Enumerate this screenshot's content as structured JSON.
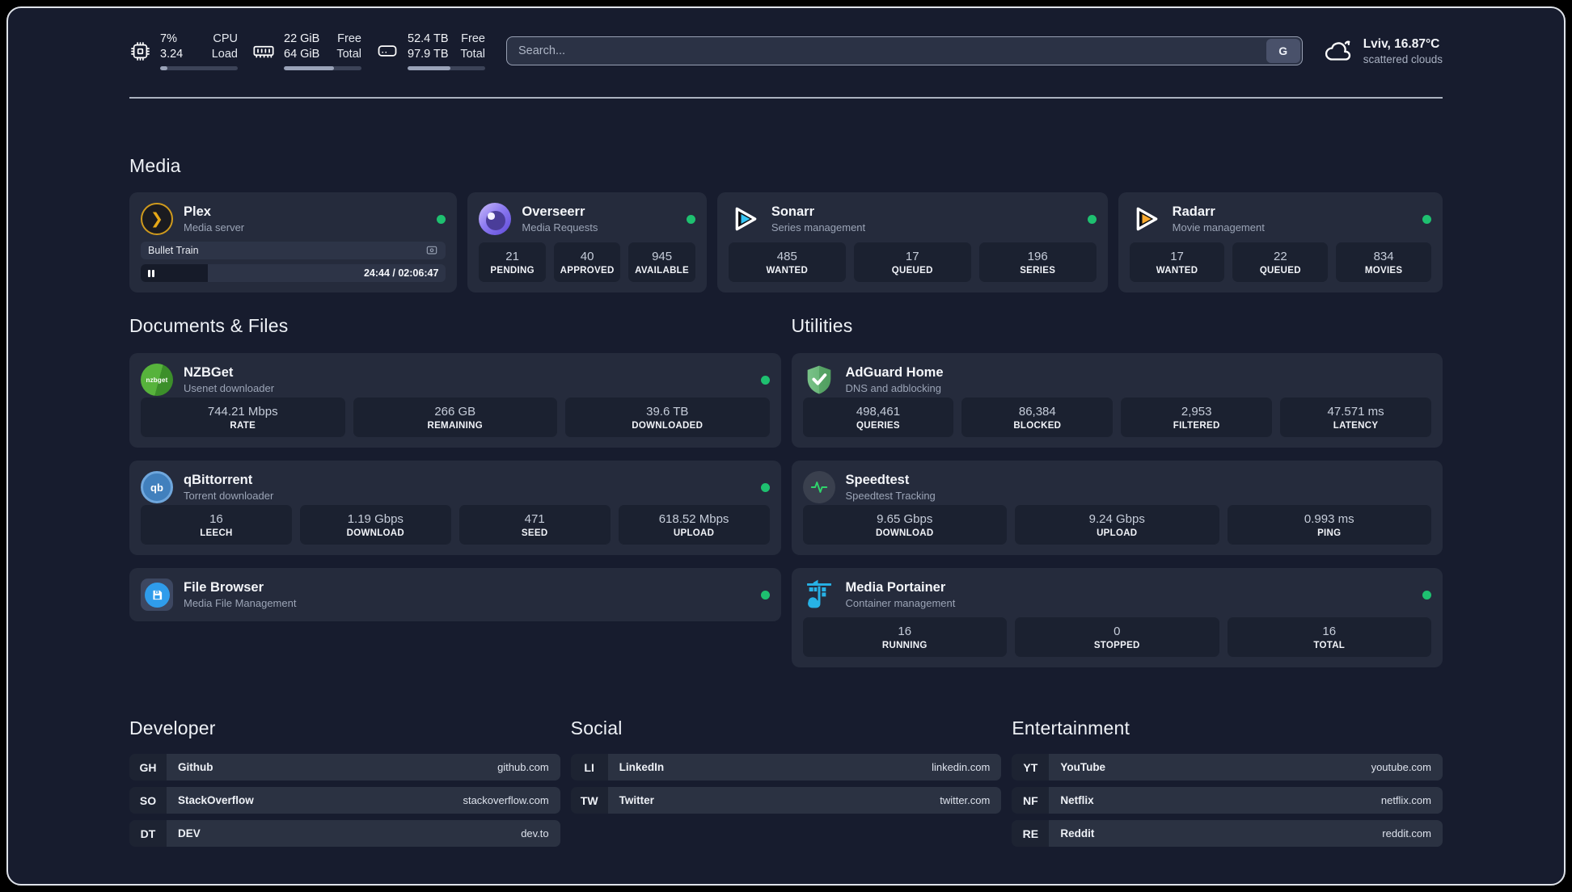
{
  "colors": {
    "status_online": "#1ec070",
    "plex": "#e5a00d",
    "sonarr": "#35c5f4",
    "radarr": "#f7a82d",
    "adguard": "#68b477",
    "portainer": "#27b2e6",
    "qbittorrent": "#4180bd",
    "nzbget": "#46a42f",
    "filebrowser": "#2f9ceb",
    "speedtest_pulse": "#2fd46b",
    "overseerr": "#7b68ee"
  },
  "header": {
    "stats": [
      {
        "icon": "cpu-icon",
        "values": [
          "7%",
          "3.24"
        ],
        "labels": [
          "CPU",
          "Load"
        ],
        "progress_pct": 9
      },
      {
        "icon": "memory-icon",
        "values": [
          "22 GiB",
          "64 GiB"
        ],
        "labels": [
          "Free",
          "Total"
        ],
        "progress_pct": 65
      },
      {
        "icon": "disk-icon",
        "values": [
          "52.4 TB",
          "97.9 TB"
        ],
        "labels": [
          "Free",
          "Total"
        ],
        "progress_pct": 55
      }
    ],
    "search": {
      "placeholder": "Search...",
      "engine": "G"
    },
    "weather": {
      "title": "Lviv, 16.87°C",
      "subtitle": "scattered clouds"
    }
  },
  "media": {
    "heading": "Media",
    "cards": [
      {
        "title": "Plex",
        "subtitle": "Media server",
        "online": true,
        "player": {
          "track": "Bullet Train",
          "time": "24:44 / 02:06:47",
          "elapsed": "24:44",
          "total": "02:06:47",
          "progress_pct": 22,
          "state": "paused"
        }
      },
      {
        "title": "Overseerr",
        "subtitle": "Media Requests",
        "online": true,
        "stats": [
          {
            "value": "21",
            "label": "PENDING"
          },
          {
            "value": "40",
            "label": "APPROVED"
          },
          {
            "value": "945",
            "label": "AVAILABLE"
          }
        ]
      },
      {
        "title": "Sonarr",
        "subtitle": "Series management",
        "online": true,
        "stats": [
          {
            "value": "485",
            "label": "WANTED"
          },
          {
            "value": "17",
            "label": "QUEUED"
          },
          {
            "value": "196",
            "label": "SERIES"
          }
        ]
      },
      {
        "title": "Radarr",
        "subtitle": "Movie management",
        "online": true,
        "stats": [
          {
            "value": "17",
            "label": "WANTED"
          },
          {
            "value": "22",
            "label": "QUEUED"
          },
          {
            "value": "834",
            "label": "MOVIES"
          }
        ]
      }
    ]
  },
  "documents": {
    "heading": "Documents & Files",
    "cards": [
      {
        "title": "NZBGet",
        "subtitle": "Usenet downloader",
        "online": true,
        "icon_text": "nzbget",
        "stats": [
          {
            "value": "744.21 Mbps",
            "label": "RATE"
          },
          {
            "value": "266 GB",
            "label": "REMAINING"
          },
          {
            "value": "39.6 TB",
            "label": "DOWNLOADED"
          }
        ]
      },
      {
        "title": "qBittorrent",
        "subtitle": "Torrent downloader",
        "online": true,
        "icon_text": "qb",
        "stats": [
          {
            "value": "16",
            "label": "LEECH"
          },
          {
            "value": "1.19 Gbps",
            "label": "DOWNLOAD"
          },
          {
            "value": "471",
            "label": "SEED"
          },
          {
            "value": "618.52 Mbps",
            "label": "UPLOAD"
          }
        ]
      },
      {
        "title": "File Browser",
        "subtitle": "Media File Management",
        "online": true
      }
    ]
  },
  "utilities": {
    "heading": "Utilities",
    "cards": [
      {
        "title": "AdGuard Home",
        "subtitle": "DNS and adblocking",
        "stats": [
          {
            "value": "498,461",
            "label": "QUERIES"
          },
          {
            "value": "86,384",
            "label": "BLOCKED"
          },
          {
            "value": "2,953",
            "label": "FILTERED"
          },
          {
            "value": "47.571 ms",
            "label": "LATENCY"
          }
        ]
      },
      {
        "title": "Speedtest",
        "subtitle": "Speedtest Tracking",
        "stats": [
          {
            "value": "9.65 Gbps",
            "label": "DOWNLOAD"
          },
          {
            "value": "9.24 Gbps",
            "label": "UPLOAD"
          },
          {
            "value": "0.993 ms",
            "label": "PING"
          }
        ]
      },
      {
        "title": "Media Portainer",
        "subtitle": "Container management",
        "online": true,
        "stats": [
          {
            "value": "16",
            "label": "RUNNING"
          },
          {
            "value": "0",
            "label": "STOPPED"
          },
          {
            "value": "16",
            "label": "TOTAL"
          }
        ]
      }
    ]
  },
  "bookmarks": [
    {
      "title": "Developer",
      "links": [
        {
          "abbr": "GH",
          "name": "Github",
          "url": "github.com"
        },
        {
          "abbr": "SO",
          "name": "StackOverflow",
          "url": "stackoverflow.com"
        },
        {
          "abbr": "DT",
          "name": "DEV",
          "url": "dev.to"
        }
      ]
    },
    {
      "title": "Social",
      "links": [
        {
          "abbr": "LI",
          "name": "LinkedIn",
          "url": "linkedin.com"
        },
        {
          "abbr": "TW",
          "name": "Twitter",
          "url": "twitter.com"
        }
      ]
    },
    {
      "title": "Entertainment",
      "links": [
        {
          "abbr": "YT",
          "name": "YouTube",
          "url": "youtube.com"
        },
        {
          "abbr": "NF",
          "name": "Netflix",
          "url": "netflix.com"
        },
        {
          "abbr": "RE",
          "name": "Reddit",
          "url": "reddit.com"
        }
      ]
    }
  ],
  "icon_glyphs": {
    "plex_chevron": "❯"
  }
}
